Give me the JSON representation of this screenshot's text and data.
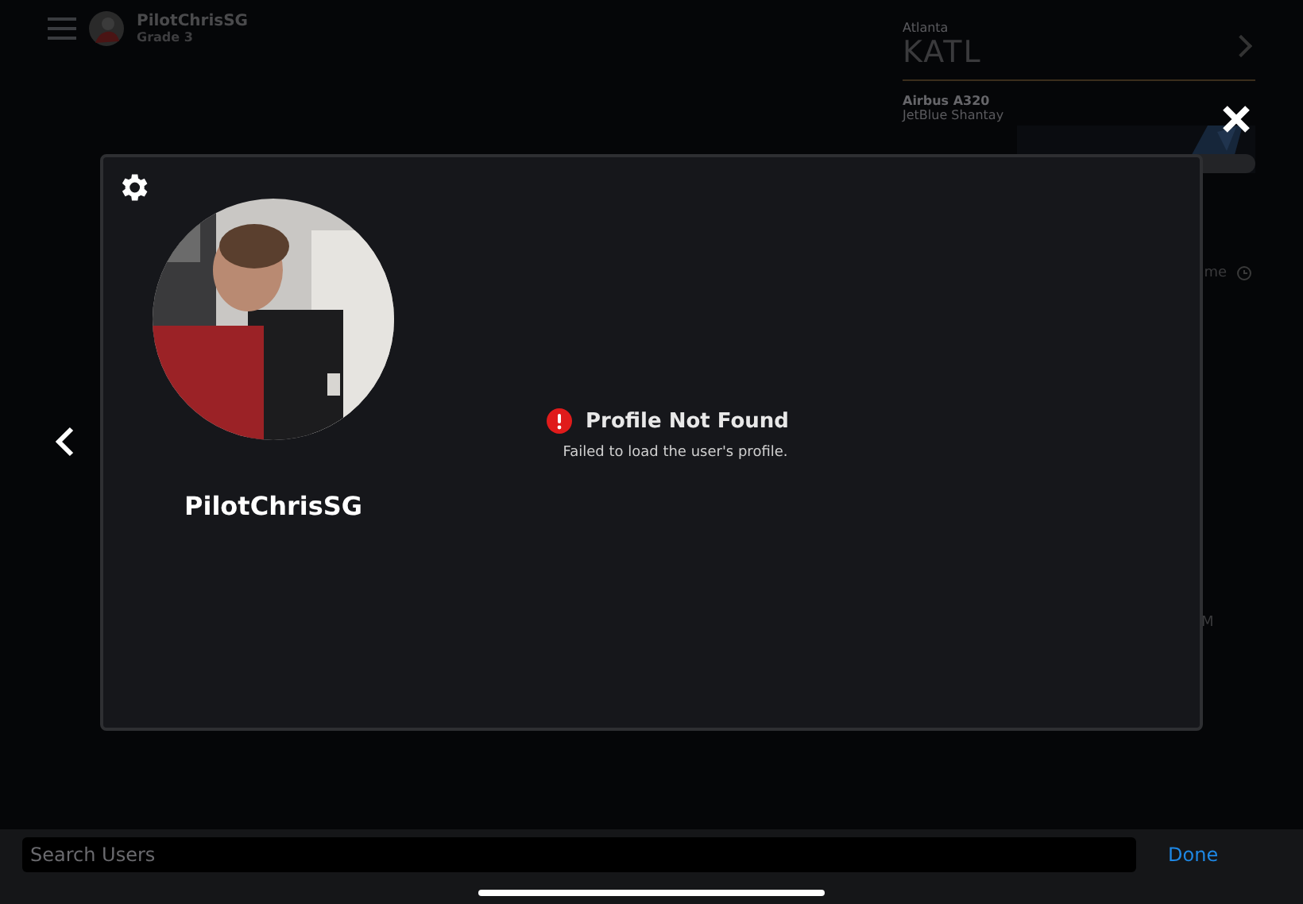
{
  "header": {
    "username": "PilotChrisSG",
    "grade": "Grade 3"
  },
  "flight_panel": {
    "city": "Atlanta",
    "airport": "KATL",
    "aircraft": "Airbus A320",
    "livery": "JetBlue Shantay",
    "time_fragment": "me",
    "period_fragment": "M"
  },
  "profile_modal": {
    "username": "PilotChrisSG",
    "error_title": "Profile Not Found",
    "error_message": "Failed to load the user's profile."
  },
  "search": {
    "placeholder": "Search Users"
  },
  "done_button": "Done"
}
